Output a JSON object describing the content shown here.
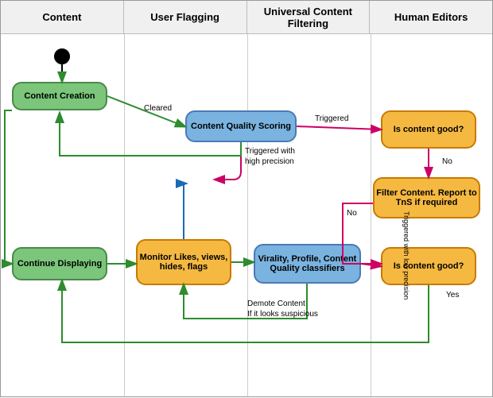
{
  "headers": [
    {
      "label": "Content",
      "id": "col-content"
    },
    {
      "label": "User Flagging",
      "id": "col-user-flagging"
    },
    {
      "label": "Universal Content Filtering",
      "id": "col-ucf"
    },
    {
      "label": "Human Editors",
      "id": "col-human-editors"
    }
  ],
  "nodes": {
    "start_circle": {
      "label": ""
    },
    "content_creation": {
      "label": "Content Creation"
    },
    "content_quality_scoring": {
      "label": "Content Quality Scoring"
    },
    "is_content_good_1": {
      "label": "Is content good?"
    },
    "filter_content": {
      "label": "Filter Content. Report to TnS if required"
    },
    "continue_displaying": {
      "label": "Continue Displaying"
    },
    "monitor_likes": {
      "label": "Monitor Likes, views, hides, flags"
    },
    "virality_profile": {
      "label": "Virality, Profile, Content Quality classifiers"
    },
    "is_content_good_2": {
      "label": "Is content good?"
    }
  },
  "edge_labels": {
    "cleared": "Cleared",
    "triggered": "Triggered",
    "triggered_high_precision": "Triggered with high precision",
    "no_1": "No",
    "no_2": "No",
    "triggered_low_precision": "Triggered with low precision",
    "demote": "Demote Content\nIf it looks suspicious",
    "yes": "Yes"
  },
  "colors": {
    "green_arrow": "#2e8b2e",
    "pink_arrow": "#cc0066",
    "blue_arrow": "#1a6bb5",
    "orange_arrow": "#cc6600"
  }
}
